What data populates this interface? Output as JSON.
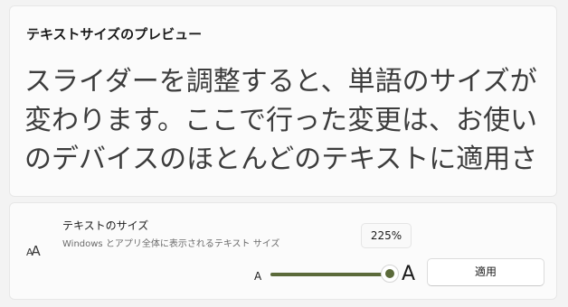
{
  "preview": {
    "title": "テキストサイズのプレビュー",
    "text": "スライダーを調整すると、単語のサイズが変わります。ここで行った変更は、お使いのデバイスのほとんどのテキストに適用され"
  },
  "text_size": {
    "icon": "text-size-icon",
    "icon_glyph_small": "A",
    "icon_glyph_large": "A",
    "title": "テキストのサイズ",
    "description": "Windows とアプリ全体に表示されるテキスト サイズ",
    "value_label": "225%",
    "slider_min_label": "A",
    "slider_max_label": "A",
    "slider_fraction": 1.0,
    "apply_label": "適用",
    "accent_color": "#5b6a3a"
  }
}
